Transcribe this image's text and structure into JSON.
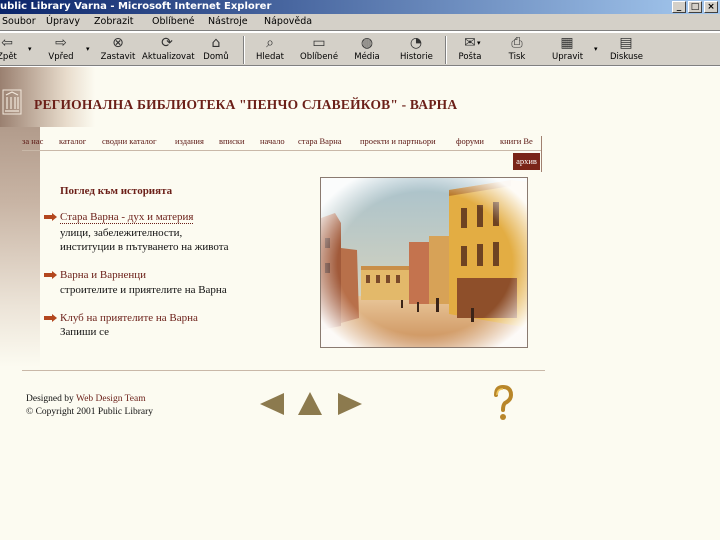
{
  "window": {
    "title": "ublic Library  Varna - Microsoft Internet Explorer",
    "buttons": [
      "_",
      "□",
      "×"
    ]
  },
  "menu": [
    "Soubor",
    "Úpravy",
    "Zobrazit",
    "Oblíbené",
    "Nástroje",
    "Nápověda"
  ],
  "toolbar": {
    "back": "Zpět",
    "forward": "Vpřed",
    "stop": "Zastavit",
    "refresh": "Aktualizovat",
    "home": "Domů",
    "search": "Hledat",
    "favorites": "Oblíbené",
    "media": "Média",
    "history": "Historie",
    "mail": "Pošta",
    "print": "Tisk",
    "edit": "Upravit",
    "discuss": "Diskuse"
  },
  "site": {
    "title": "РЕГИОНАЛНА БИБЛИОТЕКА \"ПЕНЧО СЛАВЕЙКОВ\" - ВАРНА",
    "nav": [
      "за нас",
      "каталог",
      "сводни каталог",
      "издания",
      "вписки",
      "начало",
      "стара Варна",
      "проекти и партньори",
      "форуми",
      "книги Ве"
    ],
    "search_button": "архив"
  },
  "content": {
    "section_title": "Поглед към историята",
    "links": [
      {
        "title": "Стара Варна - дух и материя",
        "desc": [
          "улици, забележителности,",
          "институции в пътуването на живота"
        ]
      },
      {
        "title": "Варна и Варненци",
        "desc": [
          "строителите и приятелите на Варна"
        ]
      },
      {
        "title": "Клуб на приятелите на Варна",
        "desc": [
          "Запиши се"
        ]
      }
    ]
  },
  "footer": {
    "designed_by": "Designed by",
    "team": "Web Design Team",
    "copyright": "© Copyright 2001 Public Library"
  },
  "colors": {
    "accent": "#6b1f18",
    "page_bg": "#fcfbf1",
    "chrome": "#d4d0c8",
    "titlebar": "#0a246a"
  }
}
